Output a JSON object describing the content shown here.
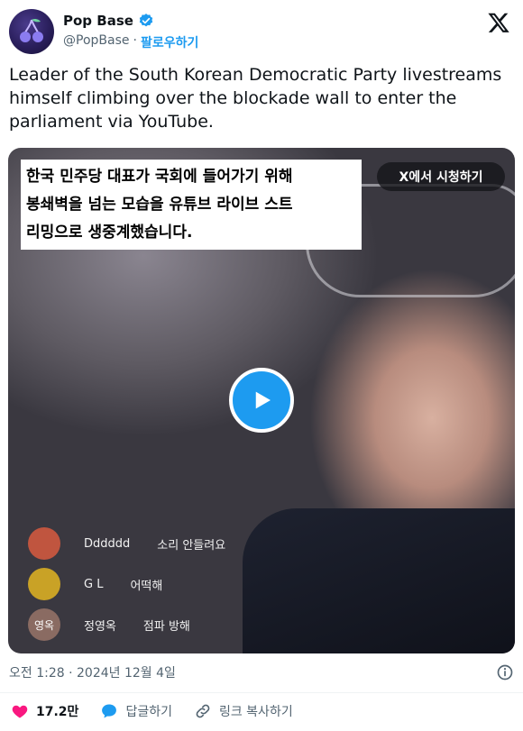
{
  "account": {
    "display_name": "Pop Base",
    "handle": "@PopBase",
    "separator": "·",
    "follow_label": "팔로우하기"
  },
  "tweet": {
    "text": "Leader of the South Korean Democratic Party livestreams himself climbing over the blockade wall to enter the parliament via YouTube."
  },
  "video": {
    "caption_lines": [
      "한국 민주당 대표가 국회에 들어가기 위해",
      "봉쇄벽을 넘는 모습을 유튜브 라이브 스트",
      "리밍으로 생중계했습니다."
    ],
    "watch_label": "X에서 시청하기",
    "comments": [
      {
        "avatar_text": "",
        "avatar_color": "#c0553f",
        "user": "Dddddd",
        "message": "소리 안들려요"
      },
      {
        "avatar_text": "",
        "avatar_color": "#c9a226",
        "user": "G L",
        "message": "어떡해"
      },
      {
        "avatar_text": "영옥",
        "avatar_color": "#8a6b62",
        "user": "정영옥",
        "message": "점파 방해"
      }
    ]
  },
  "meta": {
    "timestamp": "오전 1:28 · 2024년 12월 4일"
  },
  "actions": {
    "like_count": "17.2만",
    "reply_label": "답글하기",
    "copy_link_label": "링크 복사하기"
  },
  "colors": {
    "accent": "#1d9bf0",
    "like": "#f91880",
    "muted_text": "#536471"
  }
}
